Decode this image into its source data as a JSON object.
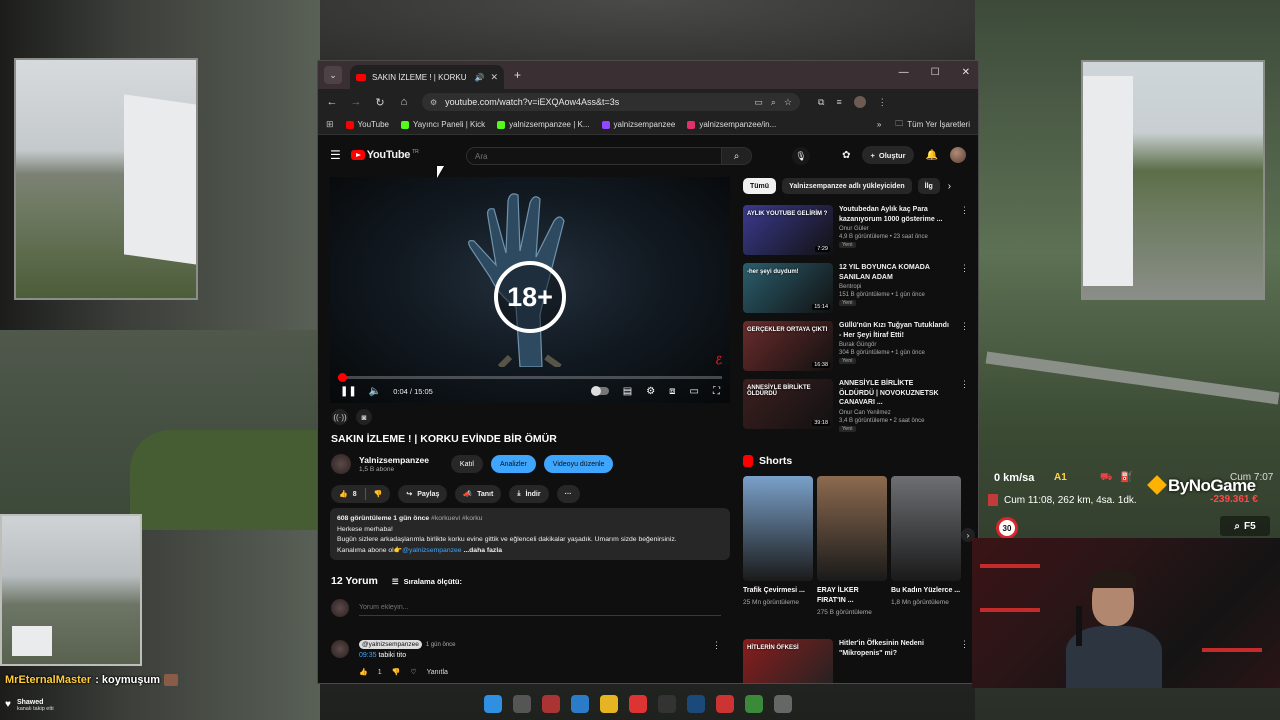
{
  "browser": {
    "tab_title": "SAKIN İZLEME ! | KORKU EVİ",
    "url": "youtube.com/watch?v=iEXQAow4Ass&t=3s",
    "bookmarks": [
      "YouTube",
      "Yayıncı Paneli | Kick",
      "yalnizsempanzee | K...",
      "yalnizsempanzee",
      "yalnizsempanzee/in..."
    ],
    "bookmark_folder": "Tüm Yer İşaretleri",
    "icons": [
      "chevron-down-icon",
      "speaker-icon",
      "close-icon",
      "plus-icon",
      "minimize-icon",
      "maximize-icon",
      "back-icon",
      "forward-icon",
      "reload-icon",
      "home-icon",
      "site-info-icon",
      "cast-icon",
      "zoom-icon",
      "star-icon",
      "extensions-icon",
      "media-icon",
      "apps-icon",
      "folder-icon"
    ]
  },
  "youtube": {
    "logo_text": "YouTube",
    "logo_region": "TR",
    "search_placeholder": "Ara",
    "create_label": "Oluştur",
    "player": {
      "time": "0:04 / 15:05",
      "progress_fraction": 0.0044,
      "badge": "18+"
    },
    "video_title": "SAKIN İZLEME ! | KORKU EVİNDE BİR ÖMÜR",
    "channel": {
      "name": "Yalnizsempanzee",
      "subs": "1,5 B abone",
      "join": "Katıl",
      "analytics": "Analizler",
      "edit": "Videoyu düzenle"
    },
    "actions": {
      "likes": "8",
      "share": "Paylaş",
      "promote": "Tanıt",
      "download": "İndir"
    },
    "description": {
      "meta": "608 görüntüleme  1 gün önce",
      "tags": "#korkuevi #korku",
      "line1": "Herkese merhaba!",
      "line2": "Bugün sizlere arkadaşlarımla birlikte korku evine gittik ve eğlenceli dakikalar yaşadık. Umarım sizde beğenirsiniz.",
      "line3_prefix": "Kanalıma abone ol👉",
      "mention": "@yalnizsempanzee",
      "more": "...daha fazla"
    },
    "comments": {
      "count": "12 Yorum",
      "sort": "Sıralama ölçütü:",
      "placeholder": "Yorum ekleyin...",
      "first": {
        "author": "@yalnizsempanzee",
        "time": "1 gün önce",
        "timestamp": "09:35",
        "text": "tabiki tito",
        "likes": "1",
        "reply": "Yanıtla"
      }
    },
    "chips": [
      "Tümü",
      "Yalnizsempanzee adlı yükleyiciden",
      "İlg"
    ],
    "recommendations": [
      {
        "title": "Youtubedan Aylık kaç Para kazanıyorum 1000 gösterime ...",
        "channel": "Onur Güler",
        "meta": "4,9 B görüntüleme • 23 saat önce",
        "badge": "Yeni",
        "duration": "7:29",
        "caption": "AYLIK YOUTUBE GELİRİM ?",
        "color": "#3b3a8e"
      },
      {
        "title": "12 YIL BOYUNCA KOMADA SANILAN ADAM",
        "channel": "Bentropi",
        "meta": "151 B görüntüleme • 1 gün önce",
        "badge": "Yeni",
        "duration": "15:14",
        "caption": "-her şeyi duydum!",
        "color": "#2a5e6d"
      },
      {
        "title": "Güllü'nün Kızı Tuğyan Tutuklandı - Her Şeyi İtiraf Etti!",
        "channel": "Burak Güngör",
        "meta": "304 B görüntüleme • 1 gün önce",
        "badge": "Yeni",
        "duration": "16:38",
        "caption": "GERÇEKLER ORTAYA ÇIKTI",
        "color": "#6b2b2b"
      },
      {
        "title": "ANNESİYLE BİRLİKTE ÖLDÜRDÜ | NOVOKUZNETSK CANAVARI ...",
        "channel": "Onur Can Yenilmez",
        "meta": "3,4 B görüntüleme • 2 saat önce",
        "badge": "Yeni",
        "duration": "39:18",
        "caption": "ANNESİYLE BİRLİKTE ÖLDÜRDÜ",
        "color": "#3d1f1f"
      }
    ],
    "shorts_title": "Shorts",
    "shorts": [
      {
        "title": "Trafik Çevirmesi ...",
        "views": "25 Mn görüntüleme",
        "color": "#7aa1c9"
      },
      {
        "title": "ERAY İLKER FIRAT'IN ...",
        "views": "275 B görüntüleme",
        "color": "#8c6a4e"
      },
      {
        "title": "Bu Kadın Yüzlerce ...",
        "views": "1,8 Mn görüntüleme",
        "color": "#6d6f72"
      }
    ],
    "last_rec": {
      "title": "Hitler'in Öfkesinin Nedeni \"Mikropenis\" mi?",
      "caption": "HİTLERİN ÖFKESİ",
      "color": "#8a1d1d"
    }
  },
  "hud": {
    "speed": "0 km/sa",
    "road": "A1",
    "clock": "Cum 7:07",
    "brand": "ByNoGame",
    "money": "-239.361 €",
    "route": "Cum 11:08, 262 km, 4sa. 1dk.",
    "speed_limit": "30",
    "key": "F5"
  },
  "stream": {
    "chat_user": "MrEternalMaster",
    "chat_message": ": koymuşum",
    "follow_name": "Shawed",
    "follow_sub": "kanalı takip etti"
  },
  "taskbar": {
    "apps": [
      {
        "icon": "windows-start-icon",
        "color": "#2f8fe0"
      },
      {
        "icon": "task-view-icon",
        "color": "#555"
      },
      {
        "icon": "snipping-icon",
        "color": "#a33"
      },
      {
        "icon": "photos-icon",
        "color": "#2b7bc8"
      },
      {
        "icon": "file-explorer-icon",
        "color": "#e6b422"
      },
      {
        "icon": "chrome-icon",
        "color": "#d33"
      },
      {
        "icon": "obs-icon",
        "color": "#333"
      },
      {
        "icon": "steam-icon",
        "color": "#1b4a7a"
      },
      {
        "icon": "chrome-profile-icon",
        "color": "#c33"
      },
      {
        "icon": "chrome-alt-icon",
        "color": "#3a8a3a"
      },
      {
        "icon": "truck-game-icon",
        "color": "#666"
      }
    ]
  }
}
